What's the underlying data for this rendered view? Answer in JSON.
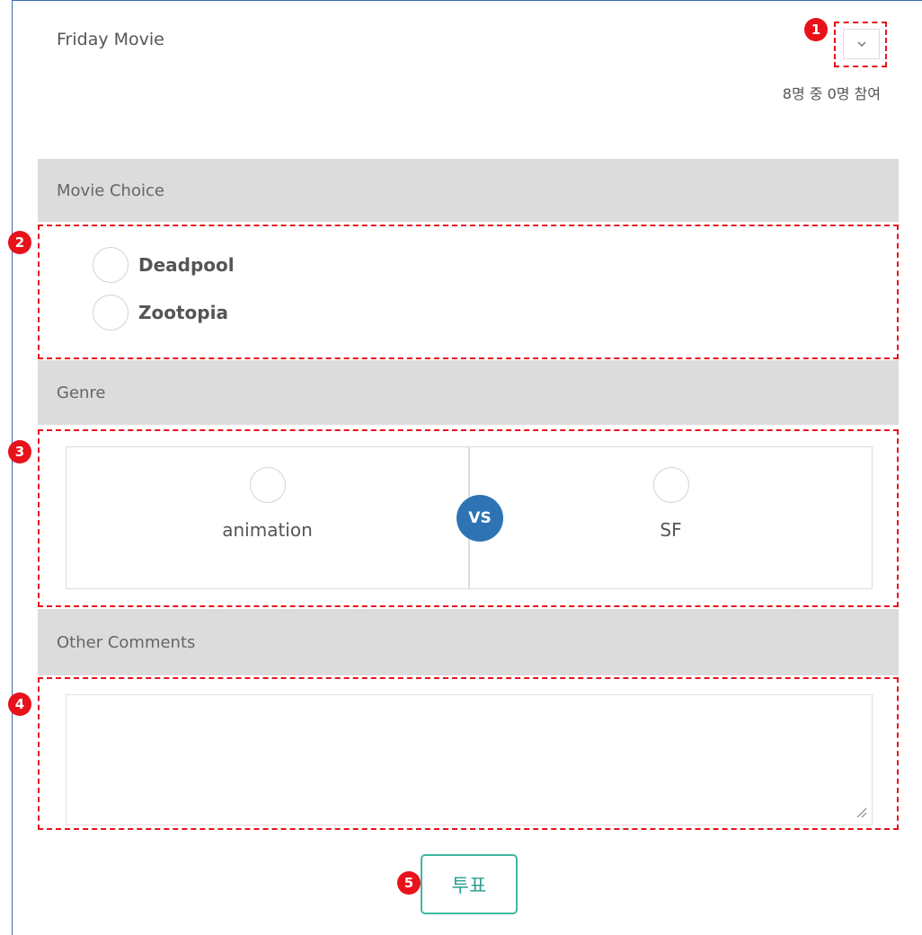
{
  "poll": {
    "title": "Friday Movie",
    "participation": "8명 중 0명 참여",
    "collapse_icon": "chevron-down-icon"
  },
  "sections": {
    "movie_choice": {
      "heading": "Movie Choice",
      "options": [
        "Deadpool",
        "Zootopia"
      ]
    },
    "genre": {
      "heading": "Genre",
      "left_option": "animation",
      "vs_label": "VS",
      "right_option": "SF"
    },
    "comments": {
      "heading": "Other Comments",
      "value": ""
    }
  },
  "vote_button": {
    "label": "투표"
  },
  "annotations": {
    "markers": [
      "1",
      "2",
      "3",
      "4",
      "5"
    ],
    "color": "#e8121b"
  },
  "colors": {
    "accent_blue": "#2e74b5",
    "vote_green": "#3fb7a2",
    "header_gray": "#dcdcdd"
  }
}
